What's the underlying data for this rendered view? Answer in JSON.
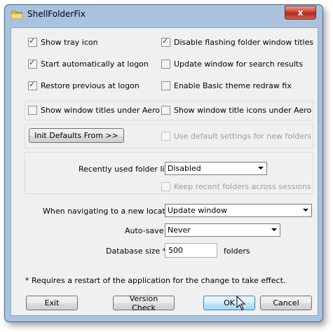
{
  "window": {
    "title": "ShellFolderFix",
    "close_label": "x"
  },
  "options": {
    "show_tray_icon": {
      "label": "Show tray icon",
      "checked": true
    },
    "start_automatically": {
      "label": "Start automatically at logon",
      "checked": true
    },
    "restore_previous": {
      "label": "Restore previous at logon",
      "checked": true
    },
    "disable_flashing": {
      "label": "Disable flashing folder window titles",
      "checked": true
    },
    "update_window_search": {
      "label": "Update window for search results",
      "checked": false
    },
    "enable_basic_theme": {
      "label": "Enable Basic theme redraw fix",
      "checked": false
    },
    "show_window_titles_aero": {
      "label": "Show window titles under Aero",
      "checked": false
    },
    "show_title_icons_aero": {
      "label": "Show window title icons under Aero",
      "checked": false
    },
    "use_default_settings": {
      "label": "Use default settings for new folders",
      "checked": false
    },
    "keep_recent_folders": {
      "label": "Keep recent folders across sessions",
      "checked": false
    }
  },
  "init_defaults_label": "Init Defaults From  >>",
  "recent_list": {
    "label": "Recently used folder list",
    "value": "Disabled"
  },
  "navigating": {
    "label": "When navigating to a new location",
    "value": "Update window"
  },
  "autosave": {
    "label": "Auto-save",
    "value": "Never"
  },
  "database": {
    "label": "Database size *",
    "value": "500",
    "unit": "folders"
  },
  "footnote": "* Requires a restart of the application for the change to take effect.",
  "buttons": {
    "exit": "Exit",
    "version_check": "Version Check",
    "ok": "OK",
    "cancel": "Cancel"
  }
}
